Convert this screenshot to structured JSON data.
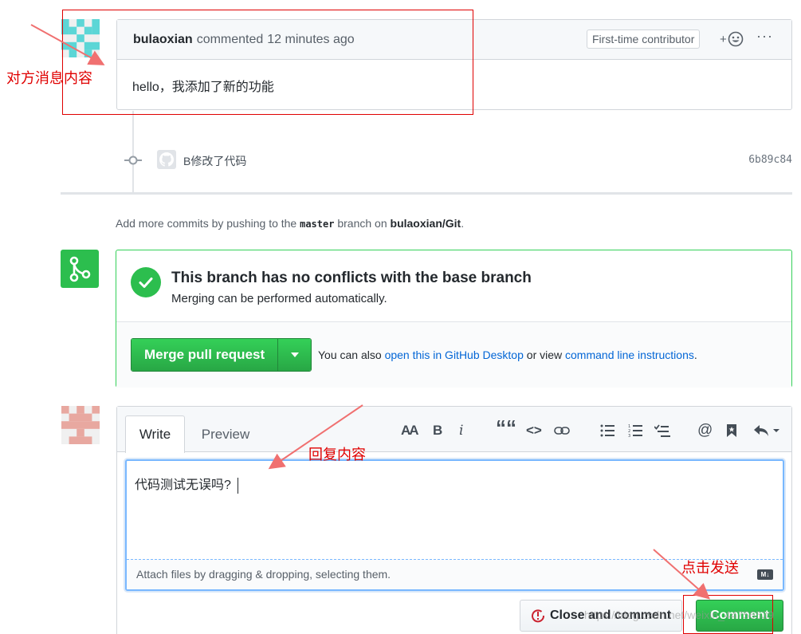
{
  "comment": {
    "author": "bulaoxian",
    "verb": "commented",
    "time": "12 minutes ago",
    "badge": "First-time contributor",
    "react_label": "+",
    "more_label": "···",
    "body": "hello，我添加了新的功能"
  },
  "commit": {
    "message": "B修改了代码",
    "sha": "6b89c84"
  },
  "push_hint": {
    "prefix": "Add more commits by pushing to the ",
    "branch": "master",
    "middle": " branch on ",
    "repo": "bulaoxian/Git",
    "suffix": "."
  },
  "merge": {
    "title": "This branch has no conflicts with the base branch",
    "subtitle": "Merging can be performed automatically.",
    "button_label": "Merge pull request",
    "alt_prefix": "You can also ",
    "alt_link1": "open this in GitHub Desktop",
    "alt_middle": " or view ",
    "alt_link2": "command line instructions",
    "alt_suffix": "."
  },
  "reply": {
    "tab_write": "Write",
    "tab_preview": "Preview",
    "toolbar": {
      "heading": "AA",
      "bold": "B",
      "italic": "i",
      "quote": "““",
      "code": "<>",
      "mention": "@"
    },
    "textarea_value": "代码测试无误吗?",
    "attach_hint": "Attach files by dragging & dropping, selecting them.",
    "md_badge": "M↓",
    "close_button": "Close and comment",
    "comment_button": "Comment"
  },
  "annotations": {
    "msg_label": "对方消息内容",
    "reply_label": "回复内容",
    "send_label": "点击发送",
    "color": "#e00000"
  },
  "watermark": "https://blog.csdn.net/weixin_44756539",
  "colors": {
    "green": "#2cbe4e",
    "link": "#0366d6",
    "border": "#d1d5da"
  }
}
